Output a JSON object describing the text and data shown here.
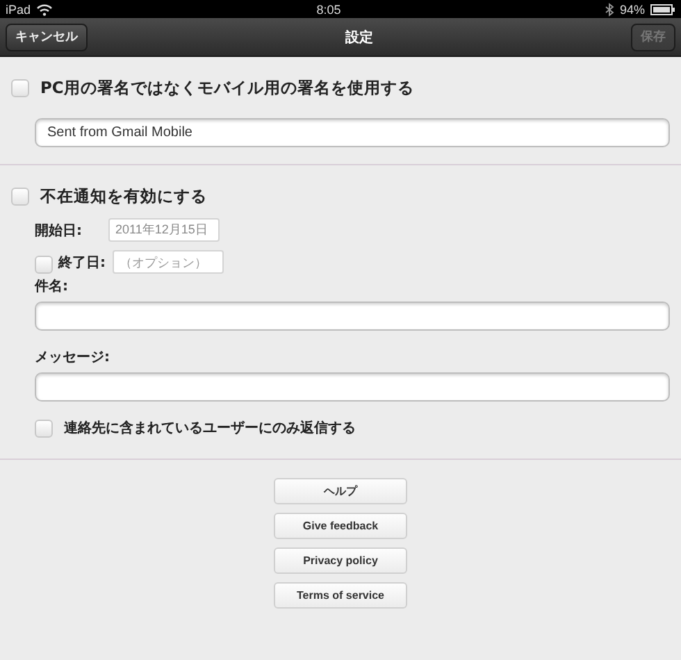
{
  "status_bar": {
    "device": "iPad",
    "time": "8:05",
    "battery": "94%"
  },
  "nav": {
    "title": "設定",
    "left_button": {
      "label": "キャンセル",
      "disabled": false
    },
    "right_button": {
      "label": "保存",
      "disabled": true
    }
  },
  "signature": {
    "checkbox": {
      "label": "PC用の署名ではなくモバイル用の署名を使用する",
      "checked": false
    },
    "value": "Sent from Gmail Mobile"
  },
  "vacation": {
    "checkbox": {
      "label": "不在通知を有効にする",
      "checked": false
    },
    "start_date": {
      "label": "開始日:",
      "value": "2011年12月15日"
    },
    "end_date": {
      "label": "終了日:",
      "placeholder": "（オプション）",
      "checked": false
    },
    "subject": {
      "label": "件名:"
    },
    "message": {
      "label": "メッセージ:"
    },
    "contacts_only": {
      "label": "連絡先に含まれているユーザーにのみ返信する",
      "checked": false
    }
  },
  "links": [
    "ヘルプ",
    "Give feedback",
    "Privacy policy",
    "Terms of service"
  ]
}
